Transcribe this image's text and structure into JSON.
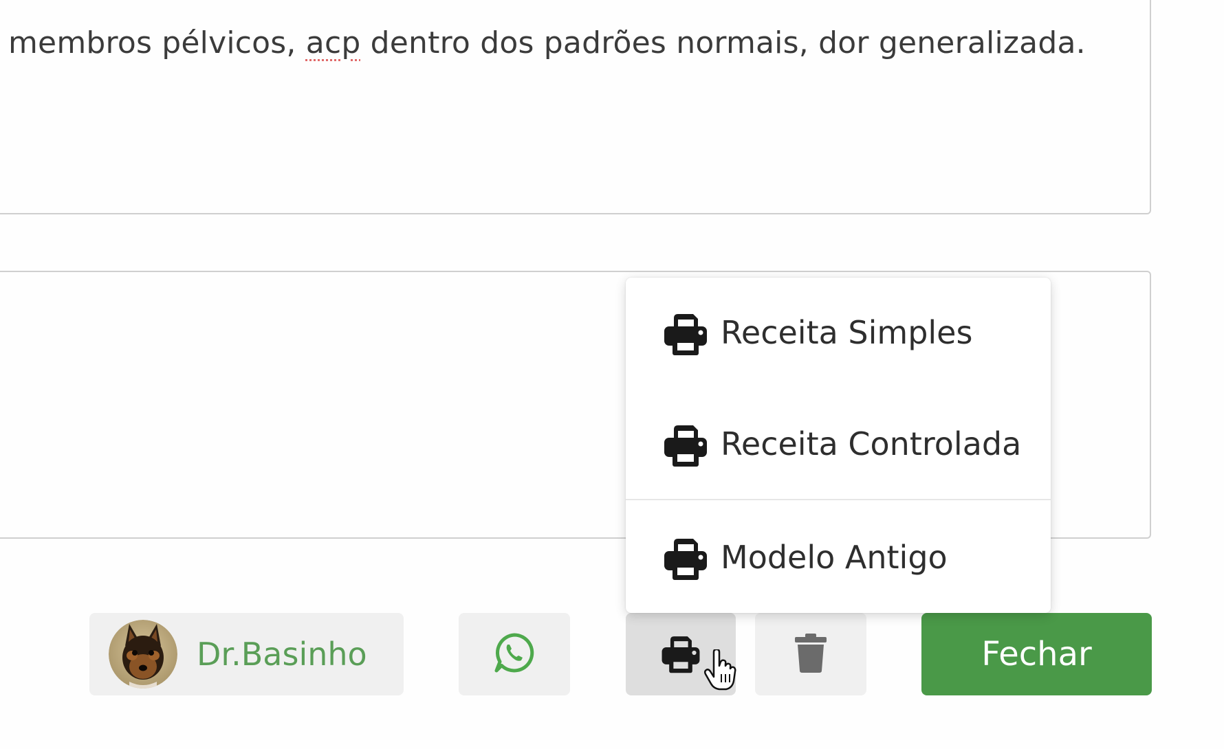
{
  "notes": {
    "text_before": "membros pélvicos, ",
    "text_misspelled": "acp",
    "text_after": " dentro dos padrões normais, dor generalizada."
  },
  "print_menu": {
    "items": [
      {
        "label": "Receita Simples",
        "icon": "printer-icon"
      },
      {
        "label": "Receita Controlada",
        "icon": "printer-icon"
      },
      {
        "label": "Modelo Antigo",
        "icon": "printer-icon"
      }
    ]
  },
  "footer": {
    "vet_name": "Dr.Basinho",
    "avatar": "dog-avatar",
    "whatsapp_icon": "whatsapp-icon",
    "print_icon": "printer-icon",
    "delete_icon": "trash-icon",
    "close_label": "Fechar"
  },
  "colors": {
    "primary_green": "#4a9948",
    "vet_name_green": "#5a9e57",
    "whatsapp_green": "#4ea94c",
    "icon_dark": "#1a1a1a",
    "trash_gray": "#6b6b6b"
  }
}
